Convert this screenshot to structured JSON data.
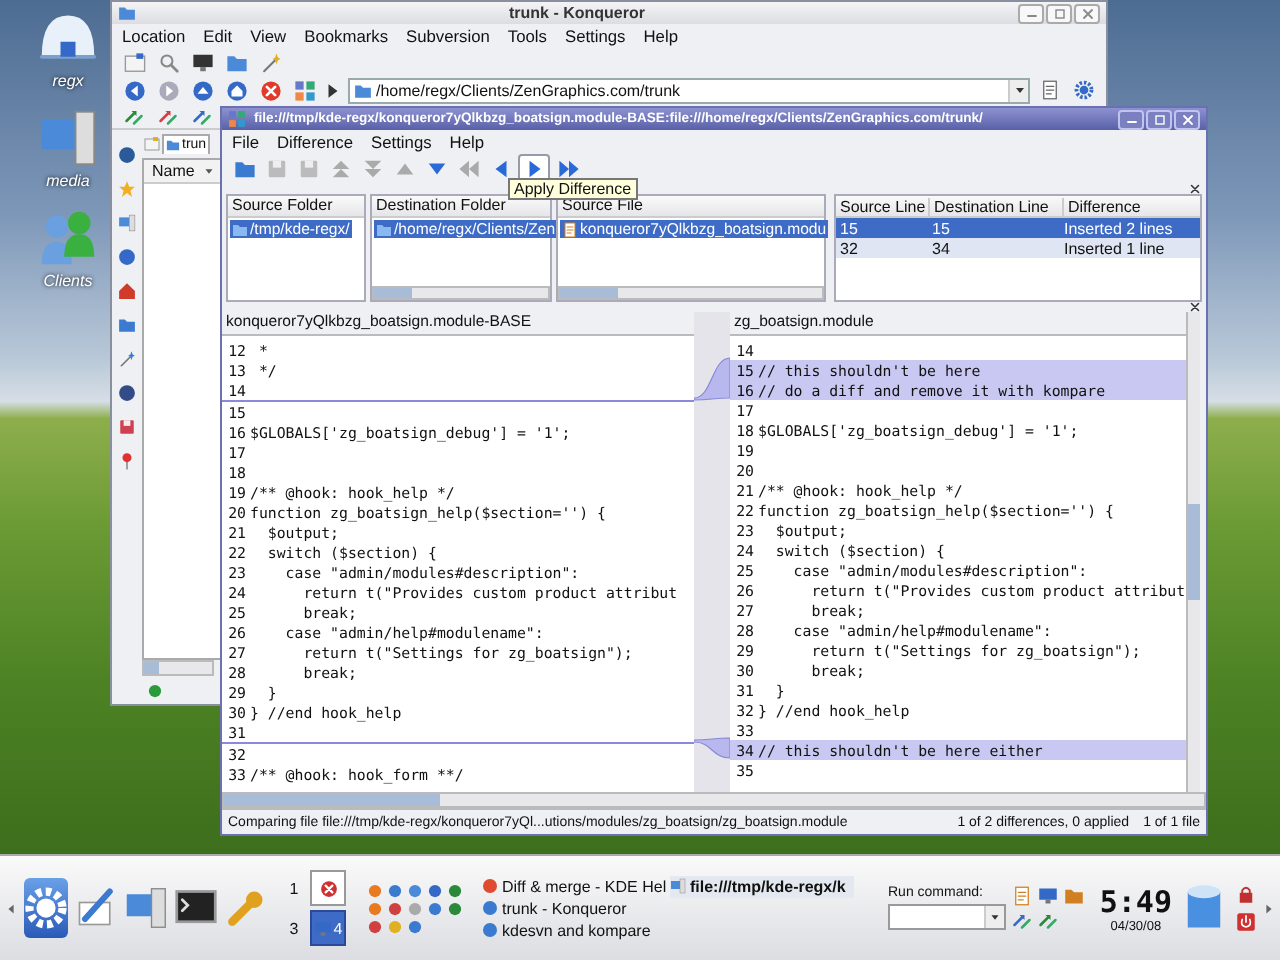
{
  "desktop_icons": [
    {
      "label": "regx"
    },
    {
      "label": "media"
    },
    {
      "label": "Clients"
    }
  ],
  "konqueror": {
    "title": "trunk - Konqueror",
    "menu": [
      "Location",
      "Edit",
      "View",
      "Bookmarks",
      "Subversion",
      "Tools",
      "Settings",
      "Help"
    ],
    "location": "/home/regx/Clients/ZenGraphics.com/trunk",
    "tab": "trun",
    "column": "Name"
  },
  "kompare": {
    "title": "file:///tmp/kde-regx/konqueror7yQlkbzg_boatsign.module-BASE:file:///home/regx/Clients/ZenGraphics.com/trunk/",
    "menu": [
      "File",
      "Difference",
      "Settings",
      "Help"
    ],
    "tooltip": "Apply Difference",
    "panels": [
      {
        "heading": "Source Folder",
        "item": "/tmp/kde-regx/",
        "selected": true
      },
      {
        "heading": "Destination Folder",
        "item": "/home/regx/Clients/Zen",
        "selected": true
      },
      {
        "heading": "Source File",
        "item": "konqueror7yQlkbzg_boatsign.modu",
        "selected": true
      }
    ],
    "differences": {
      "columns": [
        "Source Line",
        "Destination Line",
        "Difference"
      ],
      "rows": [
        {
          "cells": [
            "15",
            "15",
            "Inserted 2 lines"
          ],
          "selected": true
        },
        {
          "cells": [
            "32",
            "34",
            "Inserted 1 line"
          ],
          "selected": false
        }
      ]
    },
    "left_pane": {
      "title": "konqueror7yQlkbzg_boatsign.module-BASE",
      "lines": [
        {
          "kind": "context",
          "num": "12",
          "text": " *"
        },
        {
          "kind": "context",
          "num": "13",
          "text": " */"
        },
        {
          "kind": "context",
          "num": "14"
        },
        {
          "kind": "insertion-point"
        },
        {
          "kind": "context",
          "num": "15"
        },
        {
          "kind": "context",
          "num": "16",
          "text": "$GLOBALS['zg_boatsign_debug'] = '1';"
        },
        {
          "kind": "context",
          "num": "17"
        },
        {
          "kind": "context",
          "num": "18"
        },
        {
          "kind": "context",
          "num": "19",
          "text": "/** @hook: hook_help */"
        },
        {
          "kind": "context",
          "num": "20",
          "text": "function zg_boatsign_help($section='') {"
        },
        {
          "kind": "context",
          "num": "21",
          "text": "  $output;"
        },
        {
          "kind": "context",
          "num": "22",
          "text": "  switch ($section) {"
        },
        {
          "kind": "context",
          "num": "23",
          "text": "    case \"admin/modules#description\":"
        },
        {
          "kind": "context",
          "num": "24",
          "text": "      return t(\"Provides custom product attribut"
        },
        {
          "kind": "context",
          "num": "25",
          "text": "      break;"
        },
        {
          "kind": "context",
          "num": "26",
          "text": "    case \"admin/help#modulename\":"
        },
        {
          "kind": "context",
          "num": "27",
          "text": "      return t(\"Settings for zg_boatsign\");"
        },
        {
          "kind": "context",
          "num": "28",
          "text": "      break;"
        },
        {
          "kind": "context",
          "num": "29",
          "text": "  }"
        },
        {
          "kind": "context",
          "num": "30",
          "text": "} //end hook_help"
        },
        {
          "kind": "context",
          "num": "31"
        },
        {
          "kind": "insertion-point"
        },
        {
          "kind": "context",
          "num": "32"
        },
        {
          "kind": "context",
          "num": "33",
          "text": "/** @hook: hook_form **/"
        }
      ]
    },
    "right_pane": {
      "title": "zg_boatsign.module",
      "lines": [
        {
          "kind": "context",
          "num": "14"
        },
        {
          "kind": "added",
          "num": "15",
          "text": "// this shouldn't be here"
        },
        {
          "kind": "added",
          "num": "16",
          "text": "// do a diff and remove it with kompare"
        },
        {
          "kind": "context",
          "num": "17"
        },
        {
          "kind": "context",
          "num": "18",
          "text": "$GLOBALS['zg_boatsign_debug'] = '1';"
        },
        {
          "kind": "context",
          "num": "19"
        },
        {
          "kind": "context",
          "num": "20"
        },
        {
          "kind": "context",
          "num": "21",
          "text": "/** @hook: hook_help */"
        },
        {
          "kind": "context",
          "num": "22",
          "text": "function zg_boatsign_help($section='') {"
        },
        {
          "kind": "context",
          "num": "23",
          "text": "  $output;"
        },
        {
          "kind": "context",
          "num": "24",
          "text": "  switch ($section) {"
        },
        {
          "kind": "context",
          "num": "25",
          "text": "    case \"admin/modules#description\":"
        },
        {
          "kind": "context",
          "num": "26",
          "text": "      return t(\"Provides custom product attribut"
        },
        {
          "kind": "context",
          "num": "27",
          "text": "      break;"
        },
        {
          "kind": "context",
          "num": "28",
          "text": "    case \"admin/help#modulename\":"
        },
        {
          "kind": "context",
          "num": "29",
          "text": "      return t(\"Settings for zg_boatsign\");"
        },
        {
          "kind": "context",
          "num": "30",
          "text": "      break;"
        },
        {
          "kind": "context",
          "num": "31",
          "text": "  }"
        },
        {
          "kind": "context",
          "num": "32",
          "text": "} //end hook_help"
        },
        {
          "kind": "context",
          "num": "33"
        },
        {
          "kind": "added",
          "num": "34",
          "text": "// this shouldn't be here either"
        },
        {
          "kind": "context",
          "num": "35"
        }
      ]
    },
    "status_bar": [
      "Comparing file file:///tmp/kde-regx/konqueror7yQl...utions/modules/zg_boatsign/zg_boatsign.module",
      "1 of 2 differences, 0 applied",
      "1 of 1 file"
    ]
  },
  "taskbar": {
    "pager": [
      {
        "kind": "number",
        "label": "1",
        "selected": false
      },
      {
        "kind": "thumbnail",
        "selected": false
      },
      {
        "kind": "number",
        "label": "3",
        "selected": false
      },
      {
        "kind": "thumbnail",
        "label": "4",
        "selected": true
      }
    ],
    "tasks": [
      {
        "label": "Diff & merge - KDE Hel",
        "selected": false
      },
      {
        "label": "trunk - Konqueror",
        "selected": false
      },
      {
        "label": "kdesvn and kompare",
        "selected": false
      },
      {
        "label": "file:///tmp/kde-regx/k",
        "selected": true
      }
    ],
    "run_command": {
      "label": "Run command:"
    },
    "clock": {
      "time": "5:49",
      "date": "04/30/08"
    }
  }
}
